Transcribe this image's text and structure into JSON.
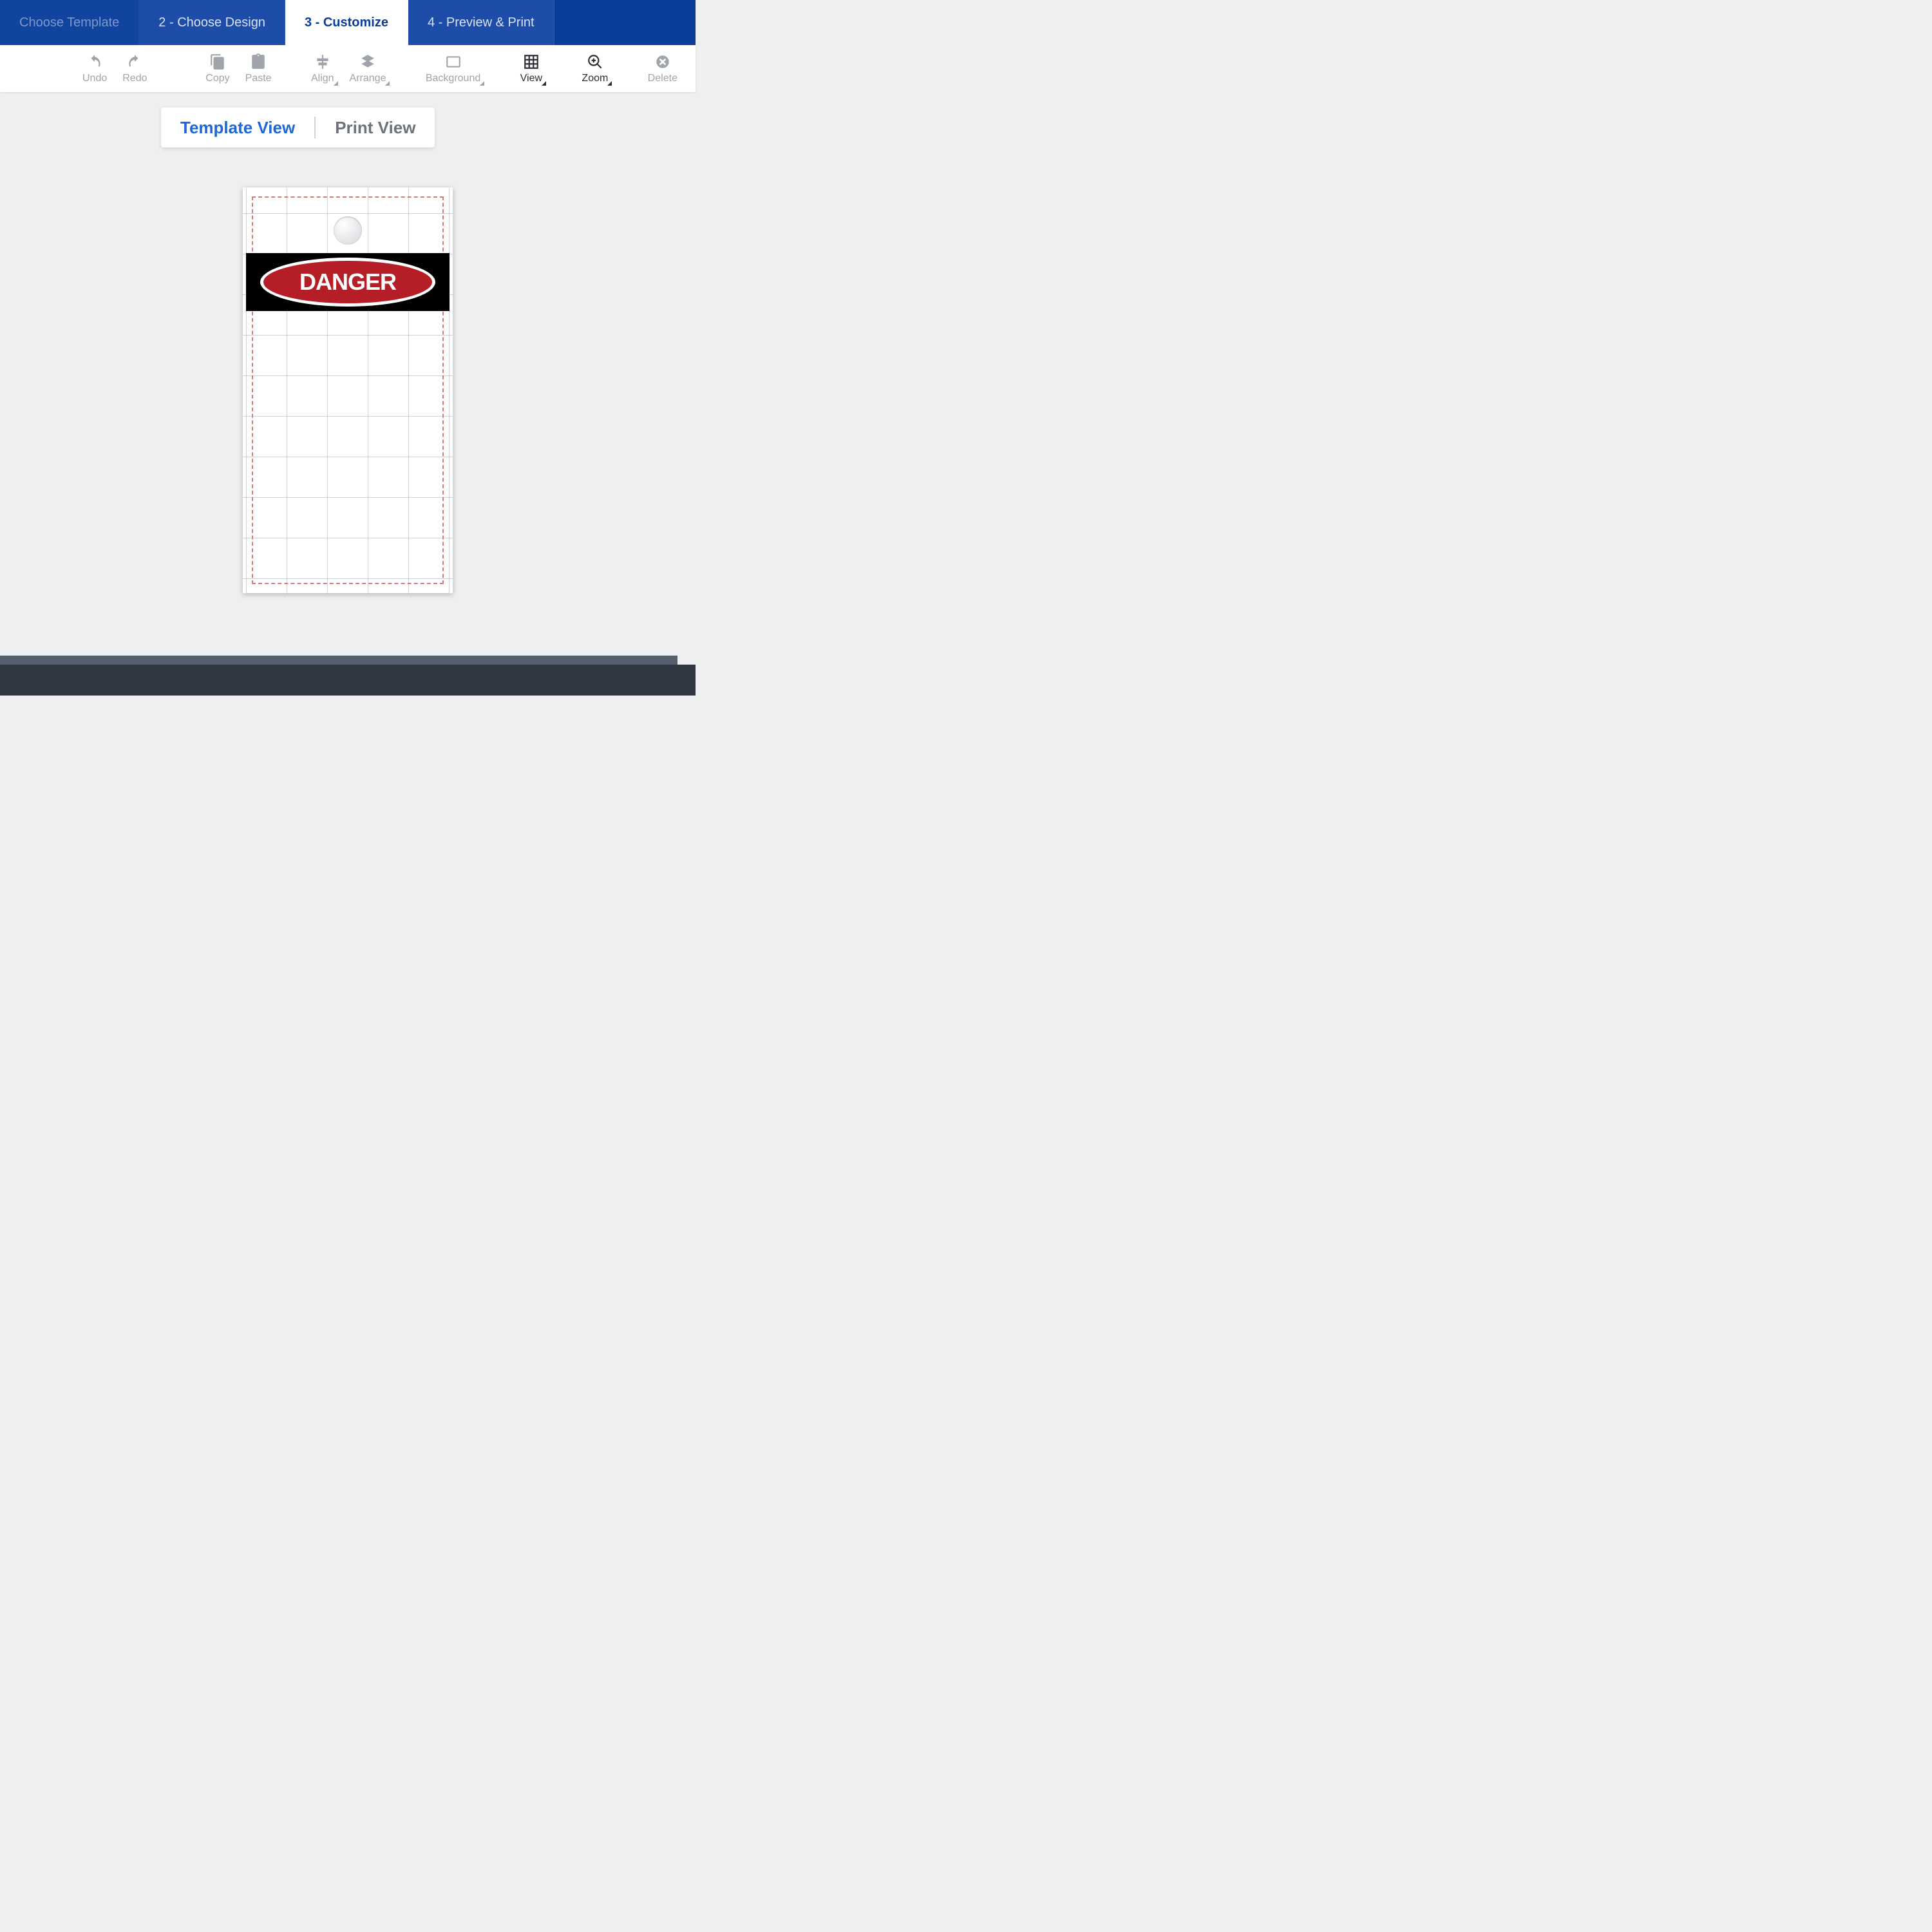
{
  "steps": {
    "s1": "Choose Template",
    "s2": "2 - Choose Design",
    "s3": "3 - Customize",
    "s4": "4 - Preview & Print"
  },
  "toolbar": {
    "undo": "Undo",
    "redo": "Redo",
    "copy": "Copy",
    "paste": "Paste",
    "align": "Align",
    "arrange": "Arrange",
    "background": "Background",
    "view": "View",
    "zoom": "Zoom",
    "delete": "Delete"
  },
  "view_switch": {
    "template": "Template View",
    "print": "Print View"
  },
  "canvas": {
    "danger_label": "DANGER"
  },
  "colors": {
    "brand_blue": "#0a3d9a",
    "danger_red": "#b51d27"
  }
}
